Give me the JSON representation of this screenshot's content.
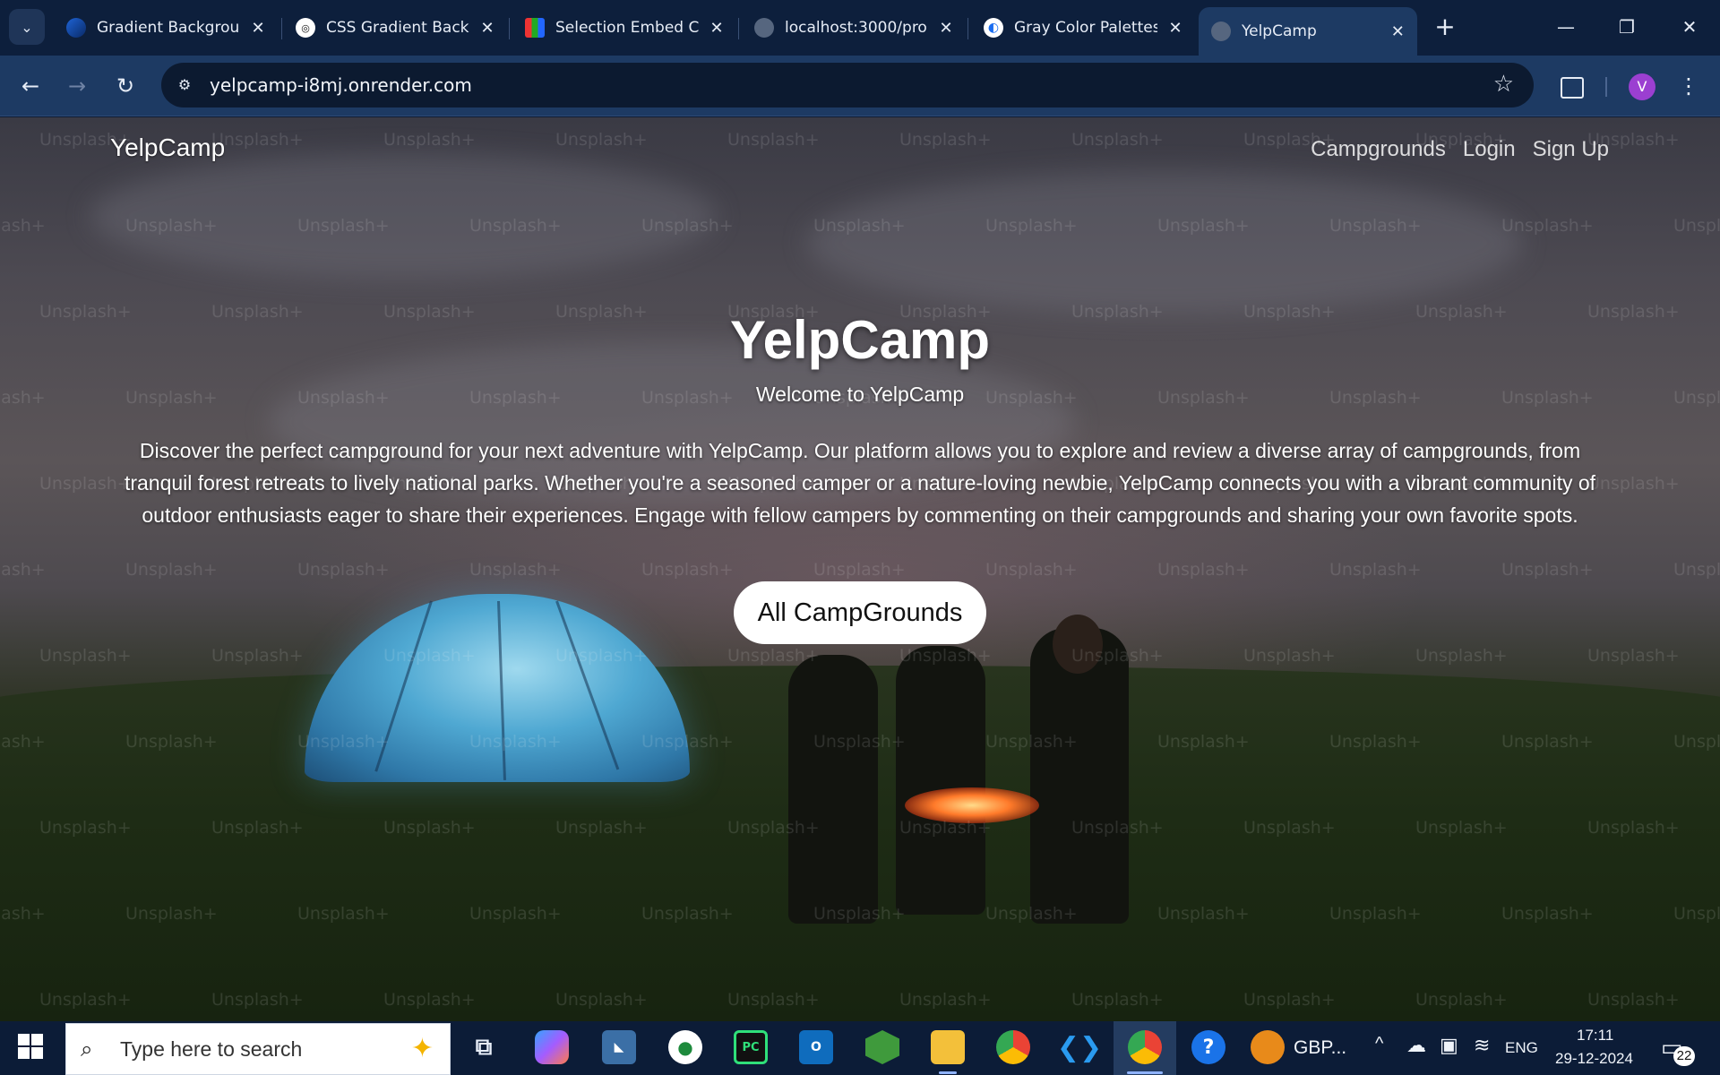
{
  "browser": {
    "tabs": [
      {
        "title": "Gradient Backgrou",
        "favicon": "globe-blue-icon",
        "active": false
      },
      {
        "title": "CSS Gradient Back",
        "favicon": "chatgpt-icon",
        "active": false
      },
      {
        "title": "Selection Embed C",
        "favicon": "zoho-icon",
        "active": false
      },
      {
        "title": "localhost:3000/pro",
        "favicon": "globe-icon",
        "active": false
      },
      {
        "title": "Gray Color Palettes",
        "favicon": "colors-icon",
        "active": false
      },
      {
        "title": "YelpCamp",
        "favicon": "globe-icon",
        "active": true
      }
    ],
    "url": "yelpcamp-i8mj.onrender.com",
    "profile_initial": "V"
  },
  "page": {
    "brand": "YelpCamp",
    "nav_links": [
      "Campgrounds",
      "Login",
      "Sign Up"
    ],
    "hero_title": "YelpCamp",
    "hero_subtitle": "Welcome to YelpCamp",
    "hero_description": "Discover the perfect campground for your next adventure with YelpCamp. Our platform allows you to explore and review a diverse array of campgrounds, from tranquil forest retreats to lively national parks. Whether you're a seasoned camper or a nature-loving newbie, YelpCamp connects you with a vibrant community of outdoor enthusiasts eager to share their experiences. Engage with fellow campers by commenting on their campgrounds and sharing your own favorite spots.",
    "cta_button": "All CampGrounds",
    "watermark_text": "Unsplash+"
  },
  "taskbar": {
    "search_placeholder": "Type here to search",
    "currency_label": "GBP...",
    "language": "ENG",
    "time": "17:11",
    "date": "29-12-2024",
    "notification_count": "22"
  },
  "colors": {
    "browser_bg": "#0d1f3c",
    "toolbar_bg": "#1d3a63",
    "taskbar_bg": "#0c1c37",
    "button_bg": "#ffffff"
  }
}
